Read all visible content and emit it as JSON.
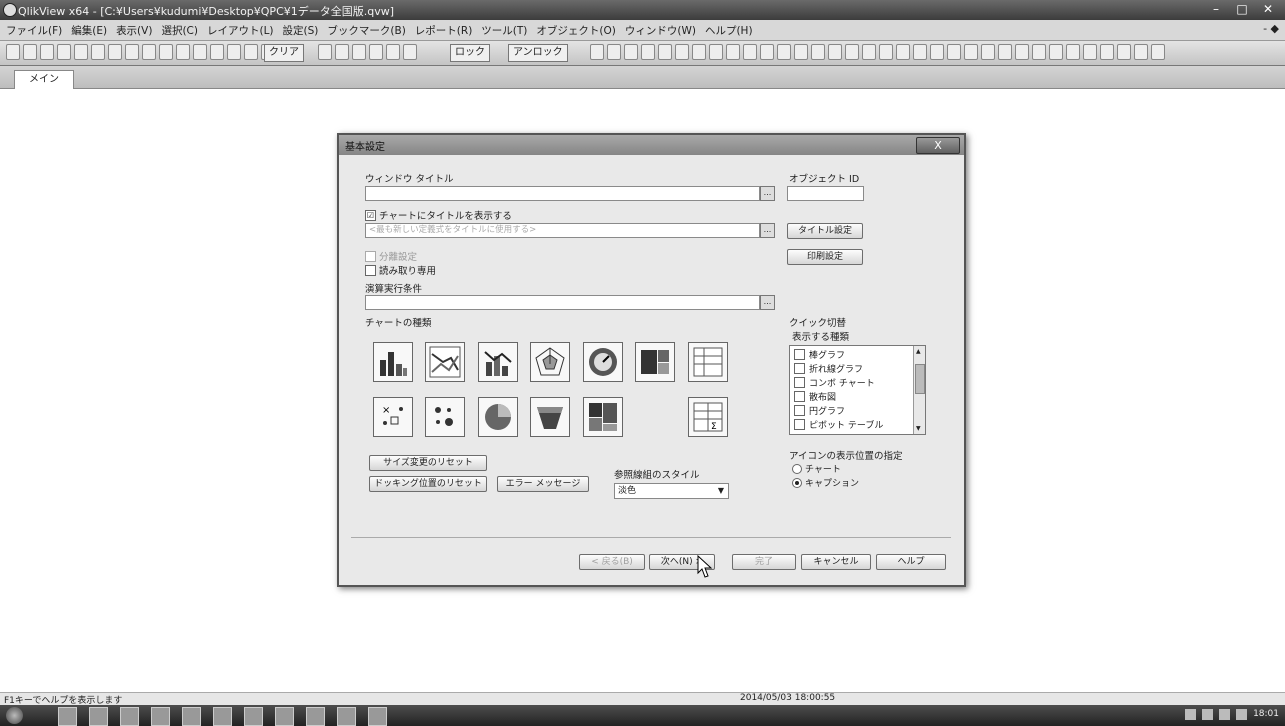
{
  "window": {
    "title": "QlikView x64 - [C:¥Users¥kudumi¥Desktop¥QPC¥1データ全国版.qvw]",
    "controls": [
      "–",
      "□",
      "✕"
    ]
  },
  "menu": {
    "items": [
      "ファイル(F)",
      "編集(E)",
      "表示(V)",
      "選択(C)",
      "レイアウト(L)",
      "設定(S)",
      "ブックマーク(B)",
      "レポート(R)",
      "ツール(T)",
      "オブジェクト(O)",
      "ウィンドウ(W)",
      "ヘルプ(H)"
    ],
    "mdi_controls": "- ◆"
  },
  "toolbar": {
    "clear_label": "クリア",
    "lock_label": "ロック",
    "unlock_label": "アンロック"
  },
  "sheet_tabs": [
    {
      "label": "メイン"
    }
  ],
  "dialog": {
    "title": "基本設定",
    "close_label": "X",
    "window_title_label": "ウィンドウ タイトル",
    "window_title_value": "",
    "object_id_label": "オブジェクト ID",
    "object_id_value": "",
    "show_title_checkbox": "チャートにタイトルを表示する",
    "show_title_checked": "☑",
    "title_placeholder": "<最も新しい定義式をタイトルに使用する>",
    "title_settings_button": "タイトル設定",
    "print_settings_button": "印刷設定",
    "detach_label": "分離設定",
    "readonly_label": "読み取り専用",
    "calc_condition_label": "演算実行条件",
    "calc_condition_value": "",
    "chart_type_label": "チャートの種類",
    "quick_switch_label": "クイック切替",
    "display_types_label": "表示する種類",
    "quick_types": [
      "棒グラフ",
      "折れ線グラフ",
      "コンボ チャート",
      "散布図",
      "円グラフ",
      "ピボット テーブル"
    ],
    "icon_position_label": "アイコンの表示位置の指定",
    "radio_chart": "チャート",
    "radio_caption": "キャプション",
    "reset_size_button": "サイズ変更のリセット",
    "reset_docking_button": "ドッキング位置のリセット",
    "error_message_button": "エラー メッセージ",
    "ref_style_label": "参照線組のスタイル",
    "ref_style_value": "淡色",
    "back_button": "< 戻る(B)",
    "next_button": "次へ(N) >",
    "finish_button": "完了",
    "cancel_button": "キャンセル",
    "help_button": "ヘルプ",
    "ellipsis": "..."
  },
  "status": {
    "help_text": "F1キーでヘルプを表示します",
    "timestamp": "2014/05/03 18:00:55"
  },
  "tray": {
    "clock": "18:01"
  }
}
